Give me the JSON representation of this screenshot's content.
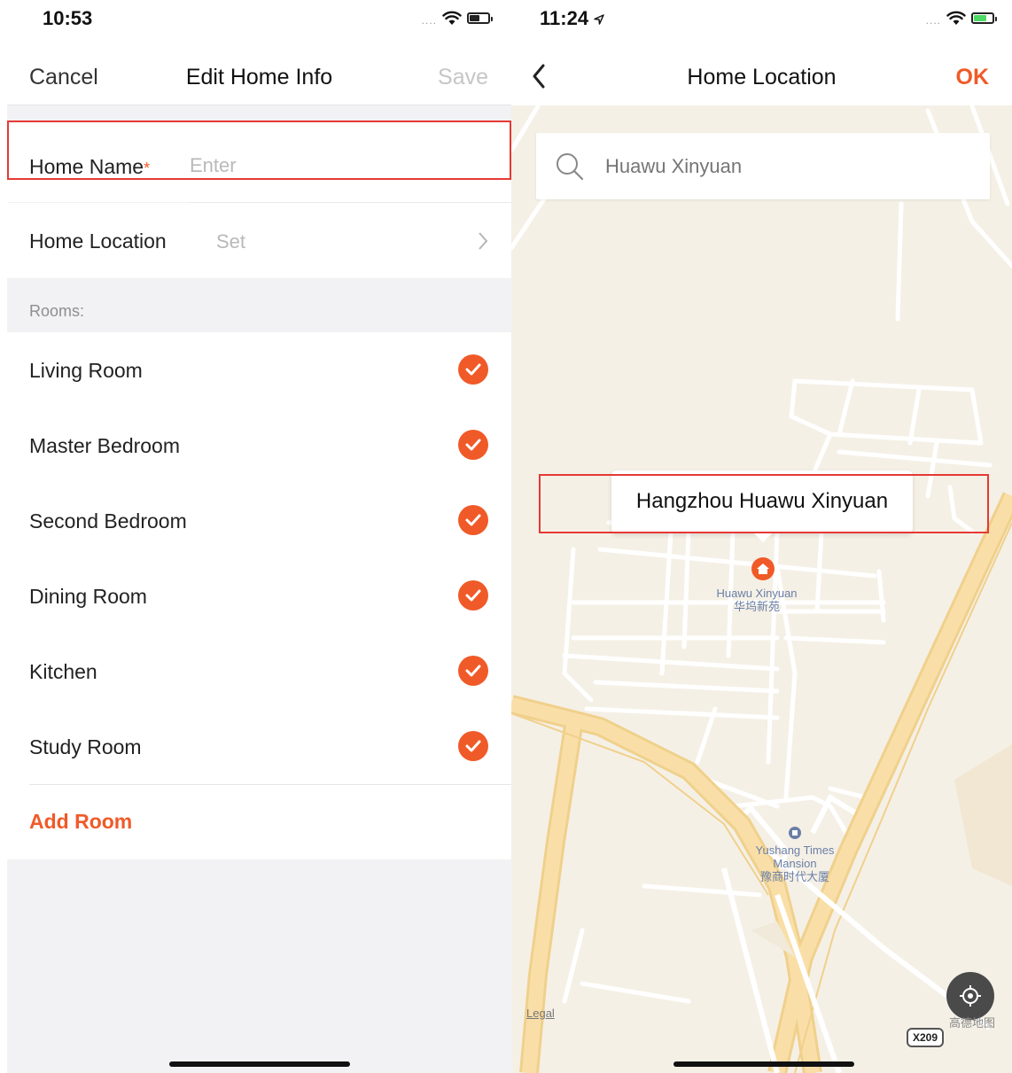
{
  "left_screen": {
    "status_bar": {
      "time": "10:53",
      "signal": "....",
      "battery_level_pct": 55
    },
    "nav": {
      "cancel_label": "Cancel",
      "title": "Edit Home Info",
      "save_label": "Save"
    },
    "home_name": {
      "label": "Home Name",
      "required_mark": "*",
      "placeholder": "Enter",
      "value": ""
    },
    "home_location": {
      "label": "Home Location",
      "value_placeholder": "Set"
    },
    "rooms_section_label": "Rooms:",
    "rooms": [
      {
        "name": "Living Room",
        "checked": true
      },
      {
        "name": "Master Bedroom",
        "checked": true
      },
      {
        "name": "Second Bedroom",
        "checked": true
      },
      {
        "name": "Dining Room",
        "checked": true
      },
      {
        "name": "Kitchen",
        "checked": true
      },
      {
        "name": "Study Room",
        "checked": true
      }
    ],
    "add_room_label": "Add Room"
  },
  "right_screen": {
    "status_bar": {
      "time": "11:24",
      "signal": "....",
      "battery_state": "charging"
    },
    "nav": {
      "title": "Home Location",
      "ok_label": "OK"
    },
    "search": {
      "placeholder": "Huawu Xinyuan",
      "value": ""
    },
    "map": {
      "callout_text": "Hangzhou Huawu Xinyuan",
      "poi_home": {
        "name_en": "Huawu Xinyuan",
        "name_zh": "华坞新苑"
      },
      "poi_mansion": {
        "name_en_line1": "Yushang Times",
        "name_en_line2": "Mansion",
        "name_zh": "豫商时代大厦"
      },
      "legal_label": "Legal",
      "provider_label": "高德地图",
      "road_badge": "X209"
    }
  },
  "colors": {
    "accent": "#f05a28",
    "highlight_box": "#e53935",
    "map_background": "#f5f0e6",
    "map_road_major": "#f9d99a",
    "map_road_minor": "#ffffff"
  },
  "icons": [
    "wifi-icon",
    "battery-icon",
    "location-arrow-icon",
    "chevron-right-icon",
    "check-icon",
    "back-chevron-icon",
    "search-icon",
    "home-pin-icon",
    "building-icon",
    "locate-icon"
  ]
}
